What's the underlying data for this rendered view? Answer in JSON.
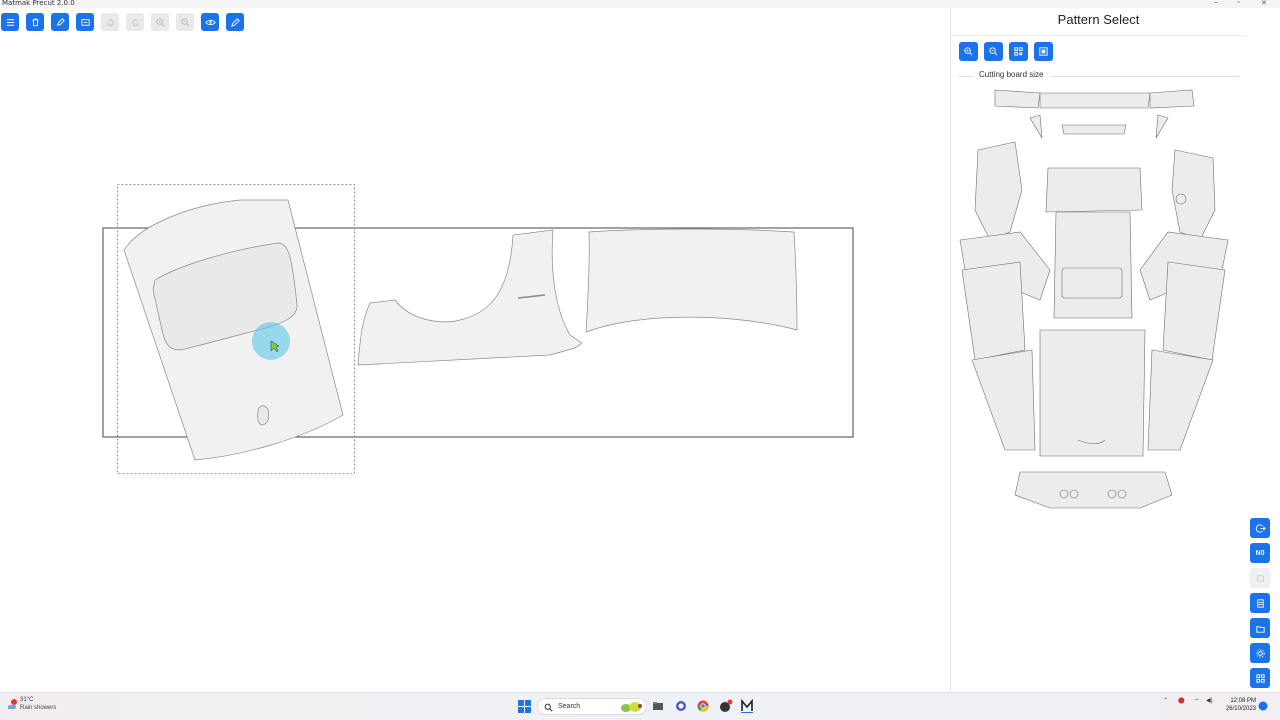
{
  "window": {
    "title": "Matmak Precut 2.0.0"
  },
  "toolbar": {
    "buttons": [
      {
        "icon": "menu-icon",
        "enabled": true
      },
      {
        "icon": "trash-icon",
        "enabled": true
      },
      {
        "icon": "pen-icon",
        "enabled": true
      },
      {
        "icon": "board-icon",
        "enabled": true
      },
      {
        "icon": "undo-icon",
        "enabled": false
      },
      {
        "icon": "redo-icon",
        "enabled": false
      },
      {
        "icon": "zoom-in-icon",
        "enabled": false
      },
      {
        "icon": "zoom-out-icon",
        "enabled": false
      },
      {
        "icon": "eye-icon",
        "enabled": true
      },
      {
        "icon": "edit-icon",
        "enabled": true
      }
    ]
  },
  "panel": {
    "title": "Pattern Select",
    "tools": [
      "zoom-in-icon",
      "zoom-out-icon",
      "grid-layout-icon",
      "select-all-icon"
    ],
    "section_label": "Cutting board size"
  },
  "rightbar": {
    "buttons": [
      {
        "icon": "logout-icon",
        "label": ""
      },
      {
        "icon": "no-icon",
        "label": "N0"
      },
      {
        "icon": "disabled-icon",
        "label": ""
      },
      {
        "icon": "document-icon",
        "label": ""
      },
      {
        "icon": "folder-icon",
        "label": ""
      },
      {
        "icon": "settings-icon",
        "label": ""
      },
      {
        "icon": "apps-icon",
        "label": ""
      }
    ]
  },
  "taskbar": {
    "weather_temp": "31°C",
    "weather_condition": "Rain showers",
    "search_label": "Search",
    "time": "12:08 PM",
    "date": "26/10/2023"
  },
  "colors": {
    "accent": "#1a73e8",
    "piece_fill": "#f1f1f1",
    "piece_stroke": "#8a8a8a"
  }
}
